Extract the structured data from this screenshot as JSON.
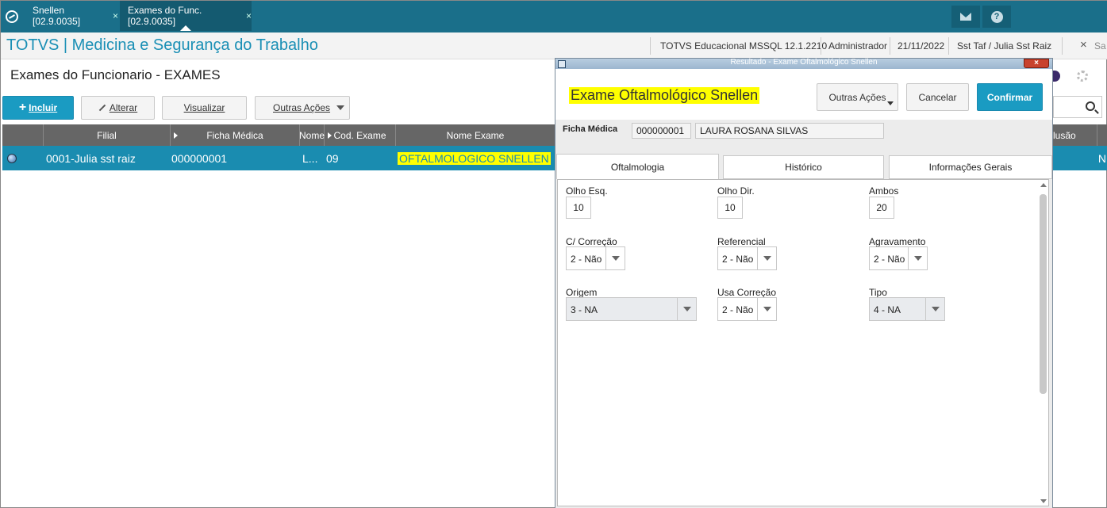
{
  "topbar": {
    "tabs": [
      {
        "label": "Snellen [02.9.0035]"
      },
      {
        "label": "Exames do Func. [02.9.0035]"
      }
    ],
    "close_glyph": "×"
  },
  "header": {
    "app_title": "TOTVS | Medicina e Segurança do Trabalho",
    "environment": "TOTVS Educacional MSSQL 12.1.2210",
    "user": "Administrador",
    "date": "21/11/2022",
    "branch": "Sst Taf / Julia Sst Raiz",
    "exit_label": "Sa"
  },
  "page": {
    "title": "Exames do Funcionario - EXAMES",
    "buttons": {
      "incluir": "Incluir",
      "alterar": "Alterar",
      "visualizar": "Visualizar",
      "outras": "Outras Ações"
    }
  },
  "grid": {
    "columns": [
      "Filial",
      "Ficha Médica",
      "Nome",
      "Cod. Exame",
      "Nome Exame"
    ],
    "rows": [
      {
        "filial": "0001-Julia sst raiz",
        "ficha": "000000001",
        "nome": "L...",
        "cod": "09",
        "nome_exame": "OFTALMOLOGICO SNELLEN"
      }
    ],
    "right_header": "lusão",
    "right_cell": "N"
  },
  "dialog": {
    "window_title": "Resultado - Exame Oftalmológico Snellen",
    "heading": "Exame Oftalmológico Snellen",
    "buttons": {
      "outras": "Outras Ações",
      "cancelar": "Cancelar",
      "confirmar": "Confirmar"
    },
    "ficha_label": "Ficha Médica",
    "ficha_code": "000000001",
    "ficha_name": "LAURA ROSANA SILVAS",
    "tabs": [
      "Oftalmologia",
      "Histórico",
      "Informações Gerais"
    ],
    "fields": {
      "olho_esq": {
        "label": "Olho Esq.",
        "value": "10"
      },
      "olho_dir": {
        "label": "Olho Dir.",
        "value": "10"
      },
      "ambos": {
        "label": "Ambos",
        "value": "20"
      },
      "correcao": {
        "label": "C/ Correção",
        "value": "2 - Não"
      },
      "referencial": {
        "label": "Referencial",
        "value": "2 - Não"
      },
      "agravamento": {
        "label": "Agravamento",
        "value": "2 - Não"
      },
      "origem": {
        "label": "Origem",
        "value": "3 - NA"
      },
      "usa_correcao": {
        "label": "Usa Correção",
        "value": "2 - Não"
      },
      "tipo": {
        "label": "Tipo",
        "value": "4 - NA"
      }
    }
  },
  "colors": {
    "topbar": "#1a6f8a",
    "accent": "#1a9bc2",
    "highlight": "#ffff00"
  }
}
